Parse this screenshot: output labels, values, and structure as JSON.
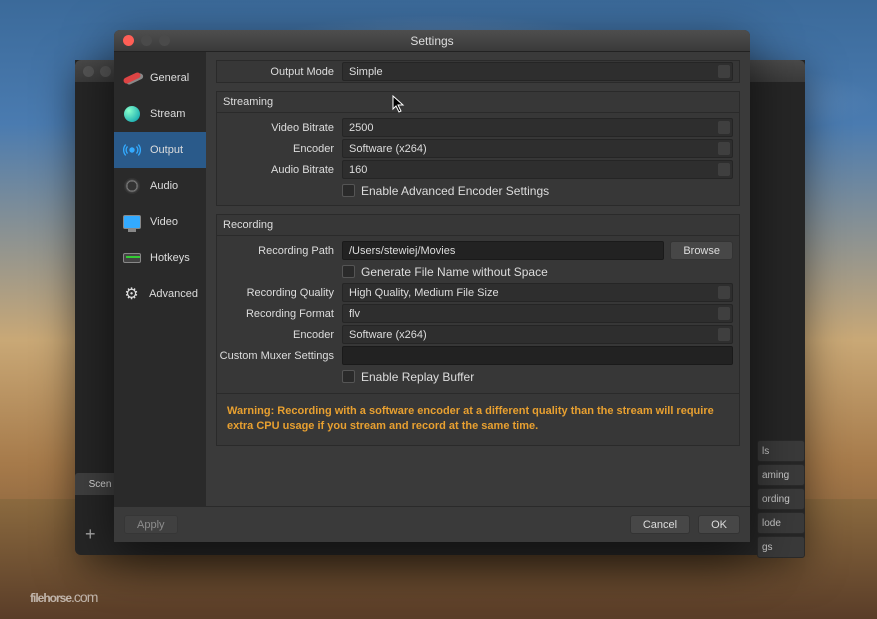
{
  "window": {
    "title": "Settings"
  },
  "sidebar": {
    "items": [
      {
        "label": "General"
      },
      {
        "label": "Stream"
      },
      {
        "label": "Output"
      },
      {
        "label": "Audio"
      },
      {
        "label": "Video"
      },
      {
        "label": "Hotkeys"
      },
      {
        "label": "Advanced"
      }
    ]
  },
  "output": {
    "mode_label": "Output Mode",
    "mode_value": "Simple",
    "streaming": {
      "title": "Streaming",
      "video_bitrate_label": "Video Bitrate",
      "video_bitrate_value": "2500",
      "encoder_label": "Encoder",
      "encoder_value": "Software (x264)",
      "audio_bitrate_label": "Audio Bitrate",
      "audio_bitrate_value": "160",
      "advanced_checkbox": "Enable Advanced Encoder Settings"
    },
    "recording": {
      "title": "Recording",
      "path_label": "Recording Path",
      "path_value": "/Users/stewiej/Movies",
      "browse": "Browse",
      "gen_filename": "Generate File Name without Space",
      "quality_label": "Recording Quality",
      "quality_value": "High Quality, Medium File Size",
      "format_label": "Recording Format",
      "format_value": "flv",
      "encoder_label": "Encoder",
      "encoder_value": "Software (x264)",
      "muxer_label": "Custom Muxer Settings",
      "muxer_value": "",
      "replay_buffer": "Enable Replay Buffer"
    },
    "warning": "Warning: Recording with a software encoder at a different quality than the stream will require extra CPU usage if you stream and record at the same time."
  },
  "footer": {
    "apply": "Apply",
    "cancel": "Cancel",
    "ok": "OK"
  },
  "bgwin": {
    "scene": "Scen",
    "plus": "+",
    "btns": [
      "ls",
      "aming",
      "ording",
      "lode",
      "gs"
    ]
  },
  "watermark": {
    "name": "filehorse",
    "suffix": ".com"
  }
}
